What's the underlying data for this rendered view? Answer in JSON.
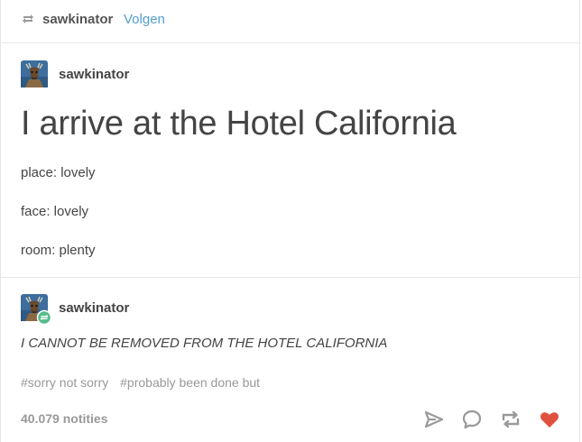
{
  "header": {
    "reblogger": "sawkinator",
    "follow_label": "Volgen"
  },
  "post": {
    "author": "sawkinator",
    "title": "I arrive at the Hotel California",
    "lines": [
      "place: lovely",
      "face: lovely",
      "room: plenty"
    ]
  },
  "reblog": {
    "author": "sawkinator",
    "text": "I CANNOT BE REMOVED FROM THE HOTEL CALIFORNIA"
  },
  "tags": [
    "#sorry not sorry",
    "#probably been done but"
  ],
  "footer": {
    "notes": "40.079 notities"
  },
  "icons": {
    "header_reblog": "reblog-icon",
    "share": "send-icon",
    "reply": "chat-bubble-icon",
    "reblog": "reblog-icon",
    "like": "heart-icon"
  },
  "colors": {
    "accent_link": "#529ecc",
    "heart": "#e0513d",
    "reblog_badge": "#56bc8a"
  }
}
